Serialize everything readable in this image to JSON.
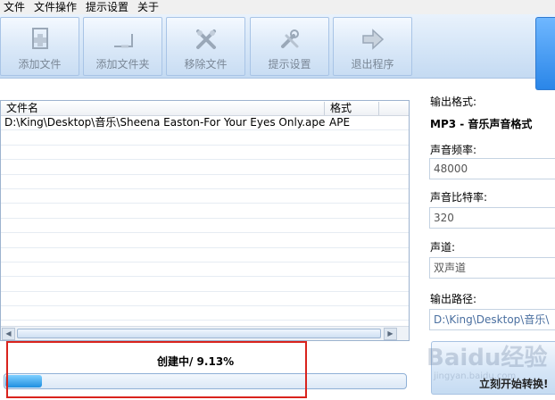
{
  "menu": [
    "文件",
    "文件操作",
    "提示设置",
    "关于"
  ],
  "toolbar": [
    {
      "label": "添加文件",
      "icon": "add-file-icon"
    },
    {
      "label": "添加文件夹",
      "icon": "add-folder-icon"
    },
    {
      "label": "移除文件",
      "icon": "remove-file-icon"
    },
    {
      "label": "提示设置",
      "icon": "settings-icon"
    },
    {
      "label": "退出程序",
      "icon": "exit-icon"
    }
  ],
  "file_list": {
    "columns": [
      "文件名",
      "格式"
    ],
    "rows": [
      {
        "name": "D:\\King\\Desktop\\音乐\\Sheena Easton-For Your Eyes Only.ape",
        "format": "APE"
      }
    ]
  },
  "settings": {
    "output_format_label": "输出格式:",
    "output_format_value": "MP3 - 音乐声音格式",
    "sample_rate_label": "声音频率:",
    "sample_rate_value": "48000",
    "bitrate_label": "声音比特率:",
    "bitrate_value": "320",
    "channel_label": "声道:",
    "channel_value": "双声道",
    "output_path_label": "输出路径:",
    "output_path_value": "D:\\King\\Desktop\\音乐\\"
  },
  "start_button": {
    "label": "立刻开始转换!"
  },
  "progress": {
    "status": "创建中/ 9.13%",
    "fraction": 0.0913
  },
  "watermark": {
    "text": "Baidu经验",
    "sub": "jingyan.baidu.com"
  },
  "colors": {
    "highlight": "#d9231d",
    "accent": "#2a86e8"
  }
}
